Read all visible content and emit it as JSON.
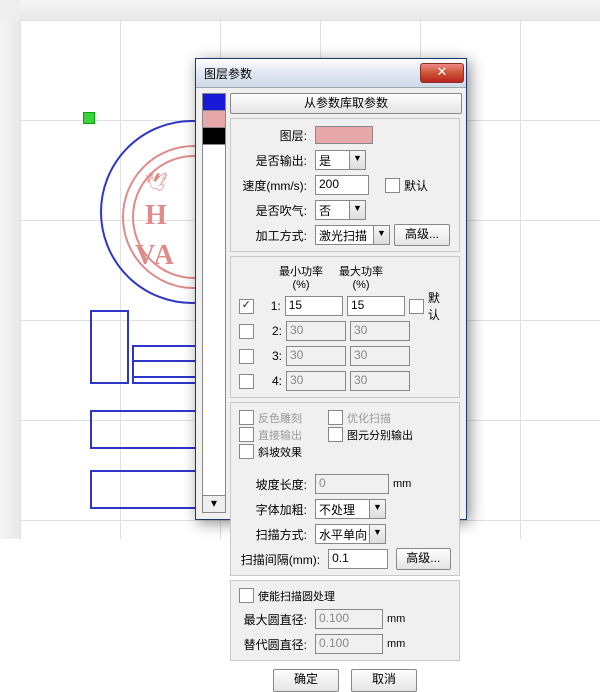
{
  "dialog": {
    "title": "图层参数",
    "top_button": "从参数库取参数",
    "labels": {
      "layer": "图层:",
      "output": "是否输出:",
      "speed": "速度(mm/s):",
      "blow": "是否吹气:",
      "mode": "加工方式:",
      "default1": "默认",
      "default2": "默认",
      "advanced1": "高级...",
      "advanced2": "高级...",
      "min_power": "最小功率(%)",
      "max_power": "最大功率(%)",
      "p1": "1:",
      "p2": "2:",
      "p3": "3:",
      "p4": "4:",
      "neg_engrave": "反色雕刻",
      "opt_scan": "优化扫描",
      "direct_out": "直接输出",
      "elem_out": "图元分别输出",
      "slope": "斜坡效果",
      "slope_len": "坡度长度:",
      "font_bold": "字体加粗:",
      "scan_dir": "扫描方式:",
      "scan_gap": "扫描间隔(mm):",
      "enable_circle": "使能扫描圆处理",
      "max_dia": "最大圆直径:",
      "sub_dia": "替代圆直径:",
      "ok": "确定",
      "cancel": "取消"
    },
    "values": {
      "output": "是",
      "speed": "200",
      "blow": "否",
      "mode": "激光扫描",
      "p1a": "15",
      "p1b": "15",
      "p2a": "30",
      "p2b": "30",
      "p3a": "30",
      "p3b": "30",
      "p4a": "30",
      "p4b": "30",
      "slope_len": "0",
      "font_bold": "不处理",
      "scan_dir": "水平单向",
      "scan_gap": "0.1",
      "max_dia": "0.100",
      "sub_dia": "0.100",
      "mm": "mm"
    }
  },
  "canvas": {
    "heart_text1": "H",
    "heart_text2": "VA",
    "dove": "🕊"
  }
}
